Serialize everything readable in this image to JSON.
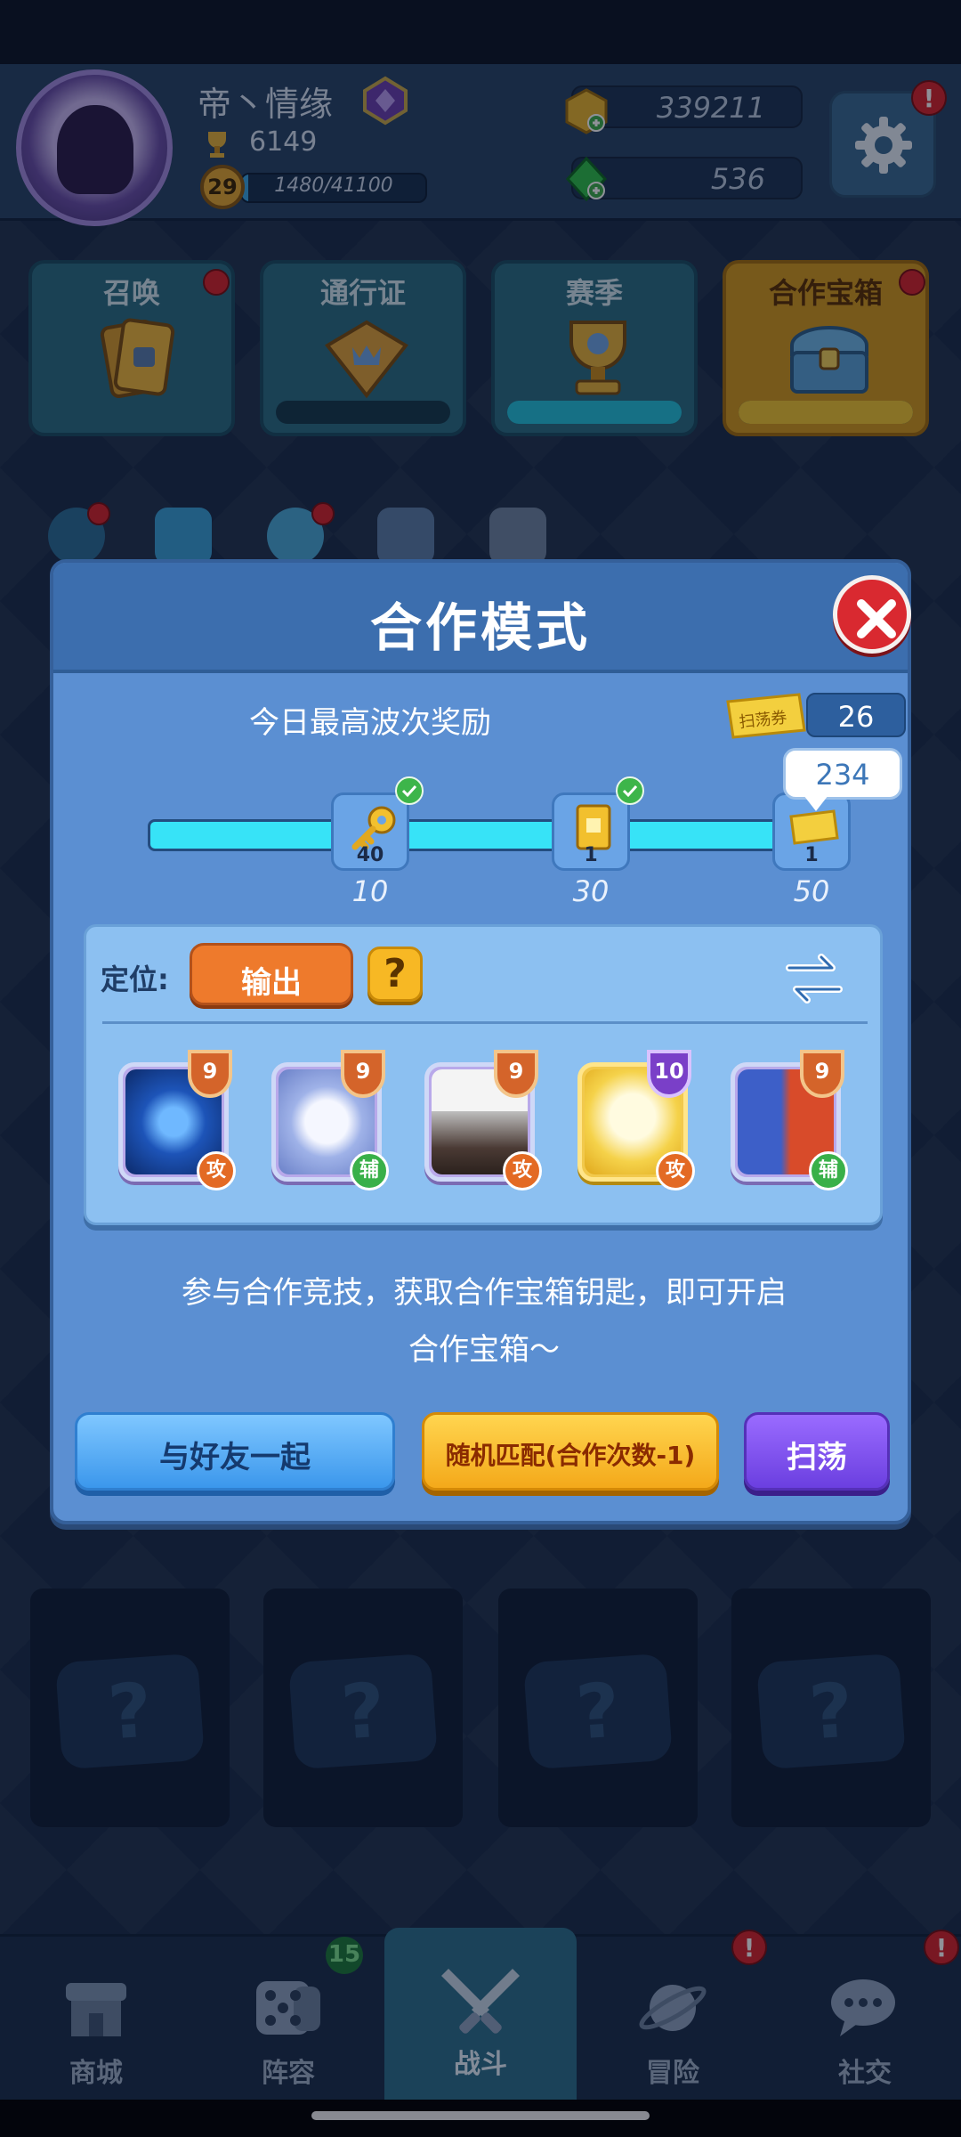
{
  "player": {
    "name": "帝丶情缘",
    "trophies": "6149",
    "level": "29",
    "xp": "1480/41100",
    "xp_progress": 0.036
  },
  "currency": {
    "gold": "339211",
    "gems": "536"
  },
  "features": [
    {
      "label": "召唤",
      "bar_progress": null
    },
    {
      "label": "通行证",
      "bar_progress": 0.0
    },
    {
      "label": "赛季",
      "bar_progress": 1.0
    },
    {
      "label": "合作宝箱",
      "bar_progress": 1.0
    }
  ],
  "modal": {
    "title": "合作模式",
    "reward_title": "今日最高波次奖励",
    "sweep_ticket_label": "扫荡券",
    "sweep_ticket_count": "26",
    "current_wave": "234",
    "progress": 1.0,
    "milestones": [
      {
        "wave": "10",
        "quantity": "40",
        "reward_icon": "key-icon",
        "claimed": true
      },
      {
        "wave": "30",
        "quantity": "1",
        "reward_icon": "chest-card-icon",
        "claimed": true
      },
      {
        "wave": "50",
        "quantity": "1",
        "reward_icon": "sweep-ticket-icon",
        "claimed": false
      }
    ],
    "role_label": "定位:",
    "role_value": "输出",
    "help_label": "?",
    "cards": [
      {
        "name": "lion-card",
        "level": "9",
        "type": "攻"
      },
      {
        "name": "moon-card",
        "level": "9",
        "type": "辅"
      },
      {
        "name": "volcano-card",
        "level": "9",
        "type": "攻"
      },
      {
        "name": "holy-cross-card",
        "level": "10",
        "type": "攻"
      },
      {
        "name": "twins-card",
        "level": "9",
        "type": "辅"
      }
    ],
    "description_line1": "参与合作竞技，获取合作宝箱钥匙，即可开启",
    "description_line2": "合作宝箱～",
    "buttons": {
      "friend": "与好友一起",
      "random": "随机匹配(合作次数-1)",
      "sweep": "扫荡"
    }
  },
  "slots": [
    "?",
    "?",
    "?",
    "?"
  ],
  "nav": [
    {
      "label": "商城",
      "icon": "shop-icon"
    },
    {
      "label": "阵容",
      "icon": "dice-icon",
      "badge": "15"
    },
    {
      "label": "战斗",
      "icon": "crossed-swords-icon",
      "active": true
    },
    {
      "label": "冒险",
      "icon": "planet-icon",
      "alert": "!"
    },
    {
      "label": "社交",
      "icon": "chat-icon",
      "alert": "!"
    }
  ],
  "alerts": {
    "settings": "!"
  },
  "colors": {
    "modal_bg": "#5b8fd2",
    "progress_fill": "#37e3f7",
    "role_button": "#ee7a2c",
    "friend_button": "#3b97ec",
    "random_button": "#f4a91a",
    "sweep_button": "#6b3fe0",
    "close_button": "#d92930"
  }
}
